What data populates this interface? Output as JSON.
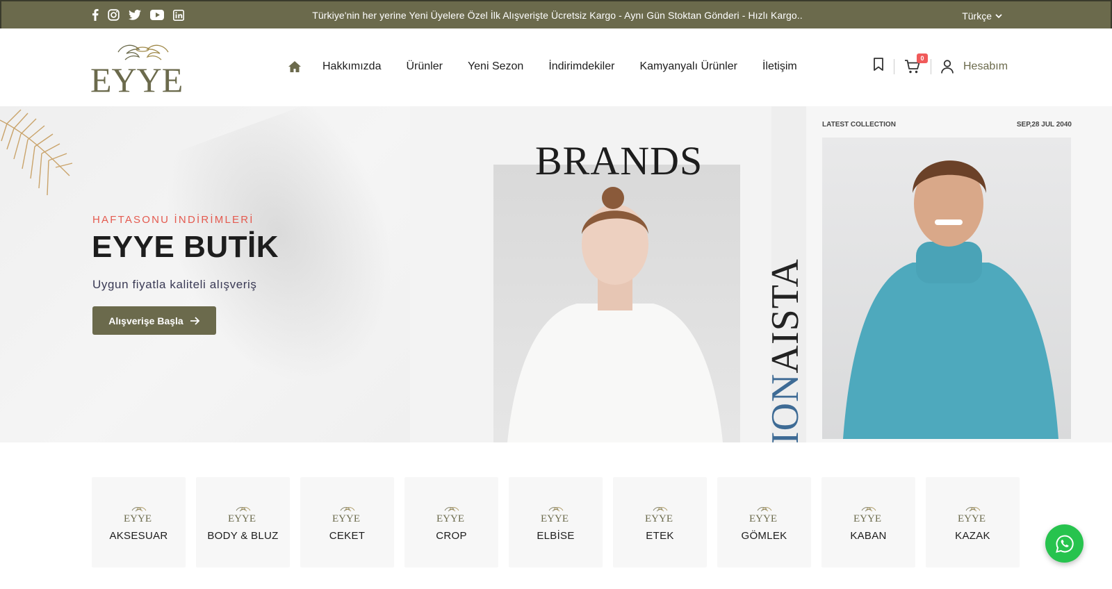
{
  "topbar": {
    "announcement": "Türkiye'nin her yerine Yeni Üyelere Özel İlk Alışverişte Ücretsiz Kargo - Aynı Gün Stoktan Gönderi - Hızlı Kargo..",
    "language": "Türkçe",
    "socials": [
      "facebook-icon",
      "instagram-icon",
      "twitter-icon",
      "youtube-icon",
      "linkedin-icon"
    ]
  },
  "header": {
    "logo_text": "EYYE",
    "nav": [
      "Hakkımızda",
      "Ürünler",
      "Yeni Sezon",
      "İndirimdekiler",
      "Kamyanyalı Ürünler",
      "İletişim"
    ],
    "cart_count": "0",
    "account_label": "Hesabım"
  },
  "hero": {
    "kicker": "HAFTASONU İNDİRİMLERİ",
    "title": "EYYE BUTİK",
    "subtitle": "Uygun fiyatla kaliteli alışveriş",
    "cta": "Alışverişe Başla",
    "banner_brands": "BRANDS",
    "banner_fashion_1": "FASHION",
    "banner_fashion_2": "AISTA",
    "latest_collection": "LATEST COLLECTION",
    "date": "SEP,28 JUL 2040"
  },
  "categories": [
    "AKSESUAR",
    "BODY & BLUZ",
    "CEKET",
    "CROP",
    "ELBİSE",
    "ETEK",
    "GÖMLEK",
    "KABAN",
    "KAZAK"
  ],
  "colors": {
    "brand": "#6b6a4c",
    "accent_red": "#e45a4f",
    "whatsapp": "#27c34e"
  }
}
